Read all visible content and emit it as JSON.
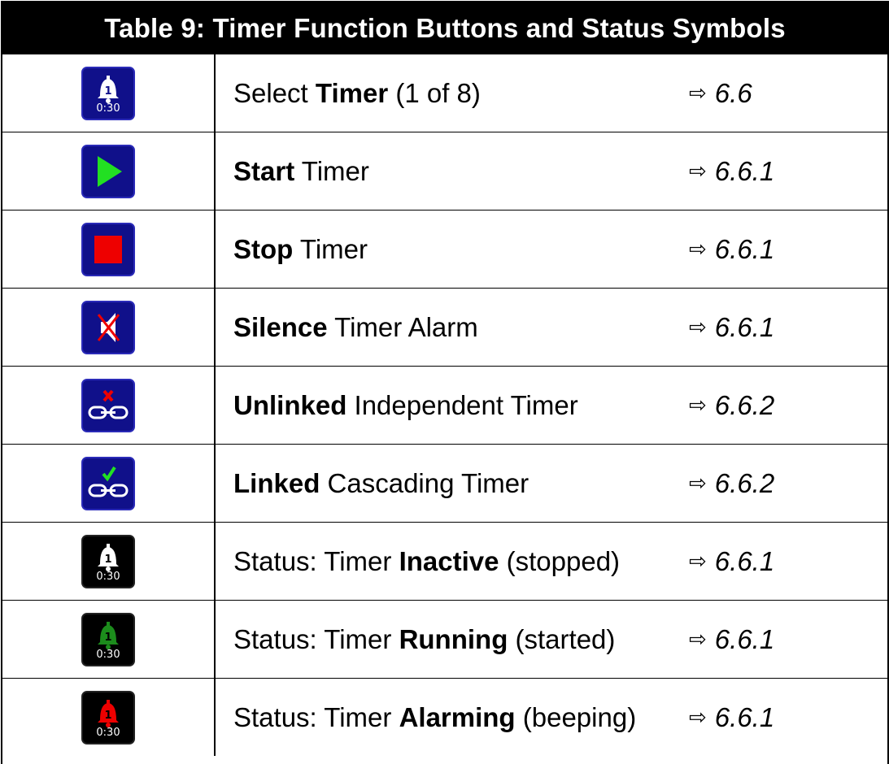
{
  "header": {
    "title": "Table 9: Timer Function Buttons and Status Symbols"
  },
  "rows": [
    {
      "icon": "timer-select-icon",
      "pre": "Select ",
      "bold": "Timer",
      "post": " (1 of 8)",
      "ref": "6.6",
      "clock": "0:30",
      "bell_color": "#ffffff"
    },
    {
      "icon": "play-icon",
      "pre": "",
      "bold": "Start",
      "post": " Timer",
      "ref": "6.6.1",
      "color": "#22e022"
    },
    {
      "icon": "stop-icon",
      "pre": "",
      "bold": "Stop",
      "post": " Timer",
      "ref": "6.6.1",
      "color": "#ee0000"
    },
    {
      "icon": "silence-icon",
      "pre": "",
      "bold": "Silence",
      "post": " Timer Alarm",
      "ref": "6.6.1",
      "color": "#ee0000"
    },
    {
      "icon": "unlinked-icon",
      "pre": "",
      "bold": "Unlinked",
      "post": " Independent Timer",
      "ref": "6.6.2",
      "color": "#ee0000"
    },
    {
      "icon": "linked-icon",
      "pre": "",
      "bold": "Linked",
      "post": " Cascading Timer",
      "ref": "6.6.2",
      "color": "#22e022"
    },
    {
      "icon": "status-inactive-icon",
      "pre": "Status: Timer ",
      "bold": "Inactive",
      "post": " (stopped)",
      "ref": "6.6.1",
      "clock": "0:30",
      "bell_color": "#ffffff"
    },
    {
      "icon": "status-running-icon",
      "pre": "Status: Timer ",
      "bold": "Running",
      "post": " (started)",
      "ref": "6.6.1",
      "clock": "0:30",
      "bell_color": "#1c8c1c"
    },
    {
      "icon": "status-alarming-icon",
      "pre": "Status: Timer ",
      "bold": "Alarming",
      "post": " (beeping)",
      "ref": "6.6.1",
      "clock": "0:30",
      "bell_color": "#ee0000"
    }
  ],
  "reference_arrow": "⇨",
  "colors": {
    "button_blue": "#10108a",
    "header_bg": "#000000"
  }
}
